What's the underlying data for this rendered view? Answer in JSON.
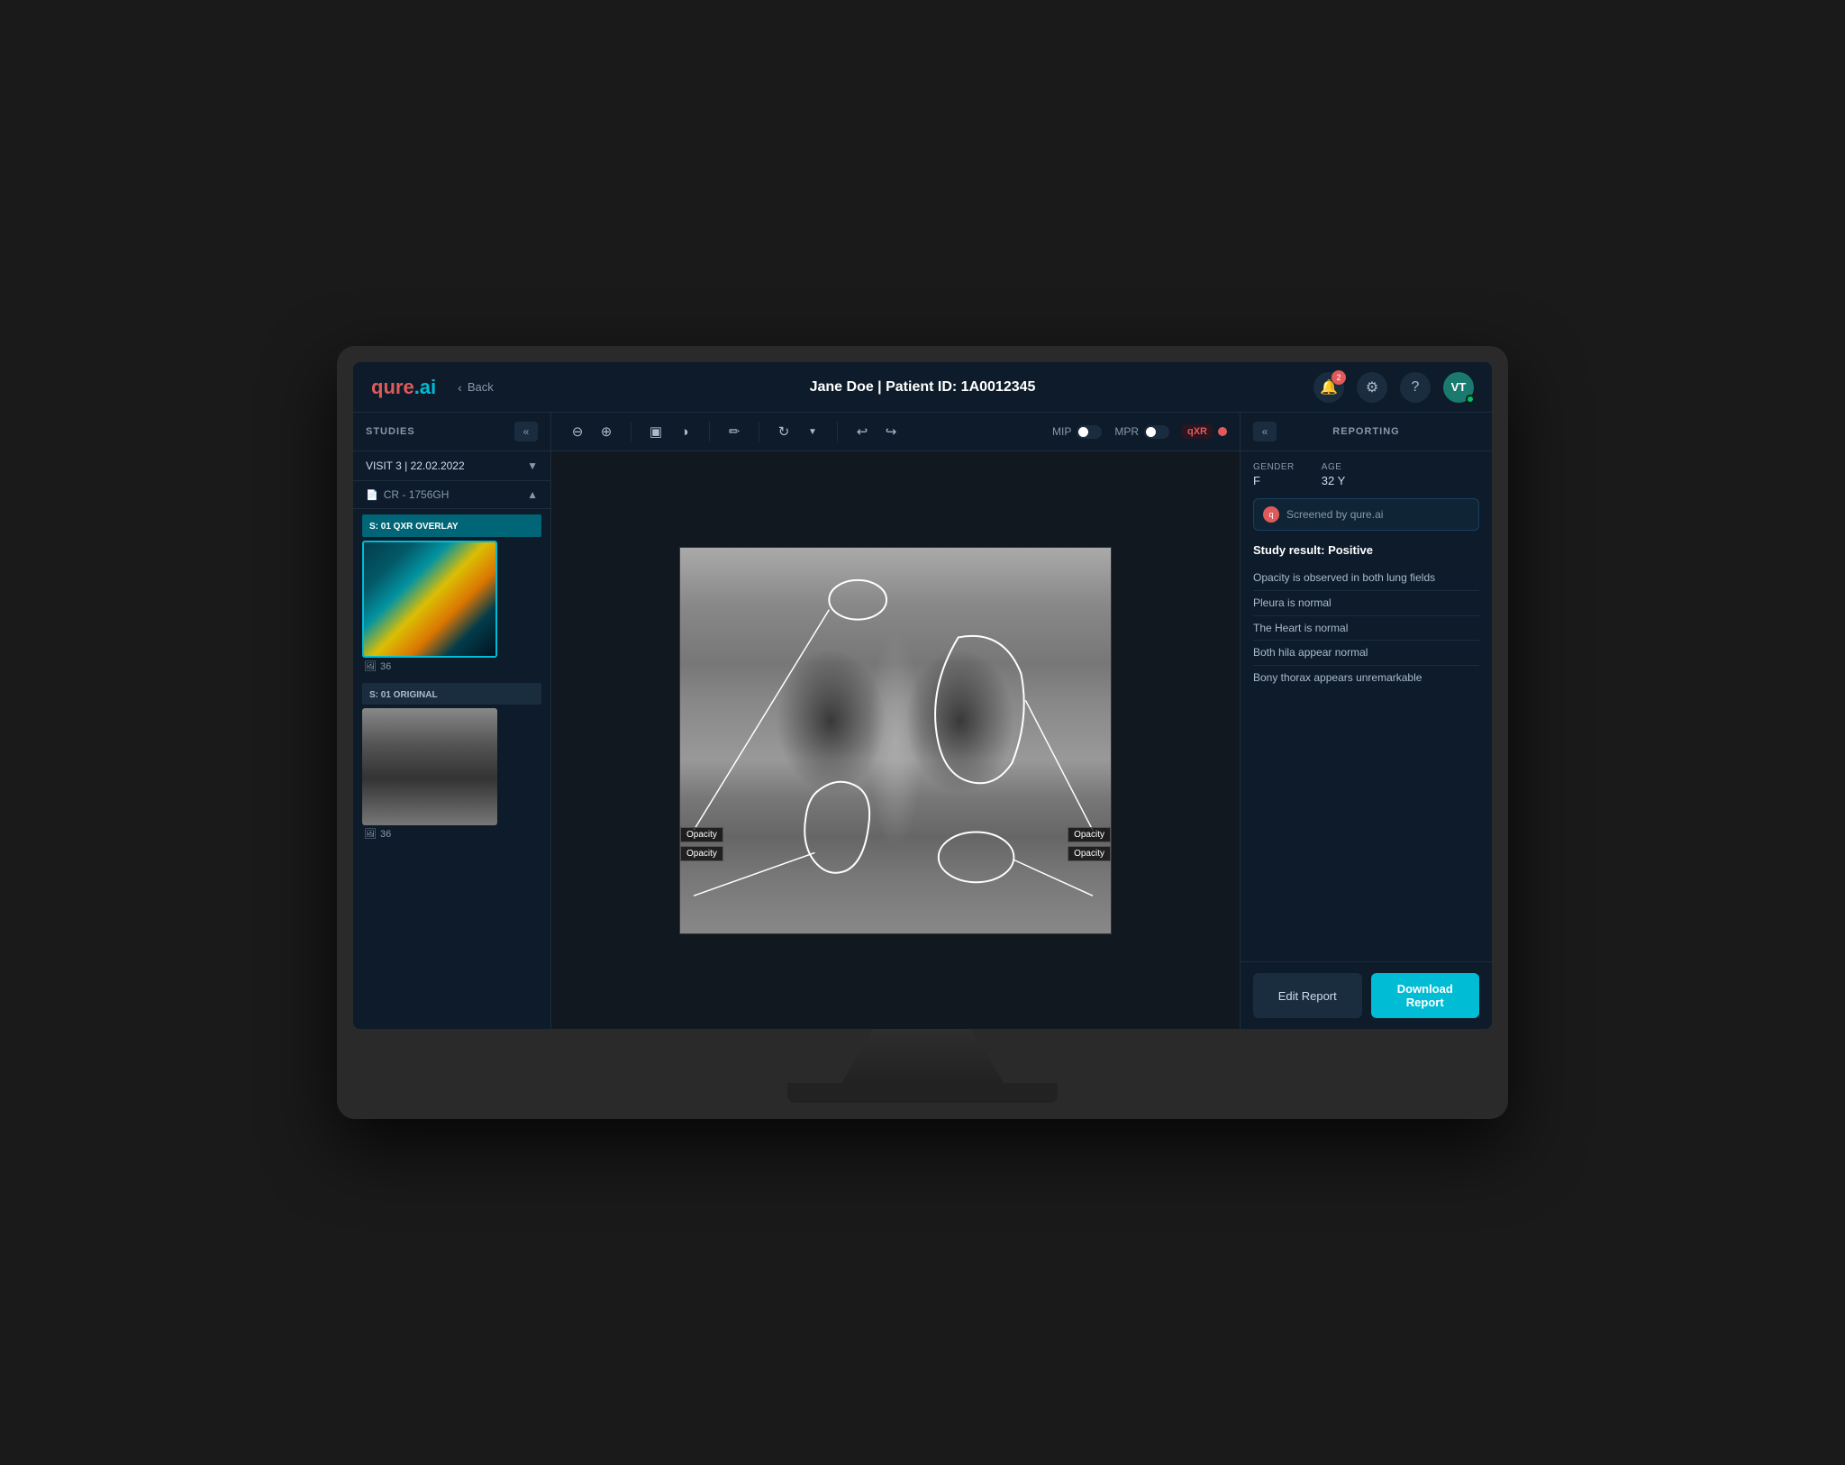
{
  "header": {
    "logo_text": "qure",
    "logo_dot": ".ai",
    "back_label": "Back",
    "patient_name": "Jane Doe",
    "patient_id": "Patient ID: 1A0012345",
    "patient_title": "Jane Doe | Patient ID: 1A0012345",
    "notification_count": "2",
    "avatar_initials": "VT"
  },
  "sidebar": {
    "title": "STUDIES",
    "collapse_icon": "«",
    "visit_label": "VISIT 3 | 22.02.2022",
    "study_label": "CR - 1756GH",
    "thumbnails": [
      {
        "label": "S: 01  QXR OVERLAY",
        "type": "overlay",
        "count": "36"
      },
      {
        "label": "S: 01  ORIGINAL",
        "type": "original",
        "count": "36"
      }
    ]
  },
  "toolbar": {
    "tools": [
      "zoom-out",
      "zoom-in",
      "window-level",
      "invert",
      "draw",
      "rotate",
      "undo",
      "redo"
    ],
    "mip_label": "MIP",
    "mpr_label": "MPR",
    "qxr_label": "qXR"
  },
  "xray": {
    "annotations": [
      {
        "label": "Opacity",
        "position": "left-mid"
      },
      {
        "label": "Opacity",
        "position": "right-mid"
      },
      {
        "label": "Opacity",
        "position": "left-bottom"
      },
      {
        "label": "Opacity",
        "position": "right-bottom"
      }
    ]
  },
  "reporting": {
    "title": "REPORTING",
    "collapse_icon": "«",
    "gender_label": "GENDER",
    "gender_value": "F",
    "age_label": "AGE",
    "age_value": "32 Y",
    "ai_screened_text": "Screened by qure.ai",
    "study_result": "Study result: Positive",
    "findings": [
      "Opacity is observed in both lung fields",
      "Pleura is normal",
      "The Heart is normal",
      "Both hila appear normal",
      "Bony thorax appears unremarkable"
    ],
    "edit_report_label": "Edit Report",
    "download_report_label": "Download Report"
  }
}
